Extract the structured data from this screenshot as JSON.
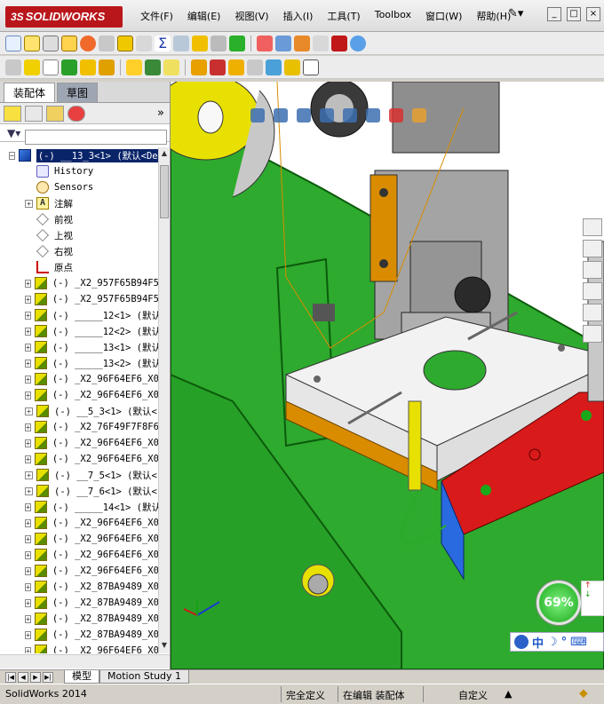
{
  "app": {
    "logo_prefix": "3S",
    "logo": "SOLIDWORKS"
  },
  "menu": [
    "文件(F)",
    "编辑(E)",
    "视图(V)",
    "插入(I)",
    "工具(T)",
    "Toolbox",
    "窗口(W)",
    "帮助(H)"
  ],
  "window_controls": [
    "_",
    "□",
    "×"
  ],
  "panel_tabs": [
    "装配体",
    "草图"
  ],
  "tree": {
    "root": "(-) __13_3<1> (默认<De",
    "items": [
      {
        "label": "History",
        "icon": "history-icon",
        "kind": "hist",
        "expandable": false
      },
      {
        "label": "Sensors",
        "icon": "sensors-icon",
        "kind": "sens",
        "expandable": false
      },
      {
        "label": "注解",
        "icon": "annotation-icon",
        "kind": "note",
        "expandable": true
      },
      {
        "label": "前视",
        "icon": "plane-icon",
        "kind": "plane",
        "expandable": false
      },
      {
        "label": "上视",
        "icon": "plane-icon",
        "kind": "plane",
        "expandable": false
      },
      {
        "label": "右视",
        "icon": "plane-icon",
        "kind": "plane",
        "expandable": false
      },
      {
        "label": "原点",
        "icon": "origin-icon",
        "kind": "origin",
        "expandable": false
      },
      {
        "label": "(-) _X2_957F65B94F5",
        "icon": "part-icon",
        "kind": "part",
        "expandable": true
      },
      {
        "label": "(-) _X2_957F65B94F5",
        "icon": "part-icon",
        "kind": "part",
        "expandable": true
      },
      {
        "label": "(-) _____12<1> (默认",
        "icon": "part-icon",
        "kind": "part",
        "expandable": true
      },
      {
        "label": "(-) _____12<2> (默认",
        "icon": "part-icon",
        "kind": "part",
        "expandable": true
      },
      {
        "label": "(-) _____13<1> (默认",
        "icon": "part-icon",
        "kind": "part",
        "expandable": true
      },
      {
        "label": "(-) _____13<2> (默认",
        "icon": "part-icon",
        "kind": "part",
        "expandable": true
      },
      {
        "label": "(-) _X2_96F64EF6_X0",
        "icon": "part-icon",
        "kind": "part",
        "expandable": true
      },
      {
        "label": "(-) _X2_96F64EF6_X0",
        "icon": "part-icon",
        "kind": "part",
        "expandable": true
      },
      {
        "label": "(-) __5_3<1> (默认<",
        "icon": "part-icon",
        "kind": "part",
        "expandable": true
      },
      {
        "label": "(-) _X2_76F49F7F8F6",
        "icon": "part-icon",
        "kind": "part",
        "expandable": true
      },
      {
        "label": "(-) _X2_96F64EF6_X0",
        "icon": "part-icon",
        "kind": "part",
        "expandable": true
      },
      {
        "label": "(-) _X2_96F64EF6_X0",
        "icon": "part-icon",
        "kind": "part",
        "expandable": true
      },
      {
        "label": "(-) __7_5<1> (默认<",
        "icon": "part-icon",
        "kind": "part",
        "expandable": true
      },
      {
        "label": "(-) __7_6<1> (默认<",
        "icon": "part-icon",
        "kind": "part",
        "expandable": true
      },
      {
        "label": "(-) _____14<1> (默认",
        "icon": "part-icon",
        "kind": "part",
        "expandable": true
      },
      {
        "label": "(-) _X2_96F64EF6_X0",
        "icon": "part-icon",
        "kind": "part",
        "expandable": true
      },
      {
        "label": "(-) _X2_96F64EF6_X0",
        "icon": "part-icon",
        "kind": "part",
        "expandable": true
      },
      {
        "label": "(-) _X2_96F64EF6_X0",
        "icon": "part-icon",
        "kind": "part",
        "expandable": true
      },
      {
        "label": "(-) _X2_96F64EF6_X0",
        "icon": "part-icon",
        "kind": "part",
        "expandable": true
      },
      {
        "label": "(-) _X2_87BA9489_X0",
        "icon": "part-icon",
        "kind": "part",
        "expandable": true
      },
      {
        "label": "(-) _X2_87BA9489_X0",
        "icon": "part-icon",
        "kind": "part",
        "expandable": true
      },
      {
        "label": "(-) _X2_87BA9489_X0",
        "icon": "part-icon",
        "kind": "part",
        "expandable": true
      },
      {
        "label": "(-) _X2_87BA9489_X0",
        "icon": "part-icon",
        "kind": "part",
        "expandable": true
      },
      {
        "label": "(-) _X2_96F64EF6_X0",
        "icon": "part-icon",
        "kind": "part",
        "expandable": true
      }
    ]
  },
  "viewport": {
    "performance_gauge": "69%",
    "ime_label": "中"
  },
  "bottom_tabs": [
    "模型",
    "Motion Study 1"
  ],
  "status": {
    "app_version": "SolidWorks 2014",
    "definition": "完全定义",
    "mode": "在编辑 装配体",
    "units": "自定义"
  },
  "colors": {
    "assembly_green": "#2eaa2e",
    "base_white": "#f2f2f2",
    "red_block": "#d91a1a",
    "orange_edge": "#d98c00",
    "yellow_part": "#e8e000",
    "grey_metal": "#9a9a9a",
    "selection_blue": "#0a246a"
  }
}
